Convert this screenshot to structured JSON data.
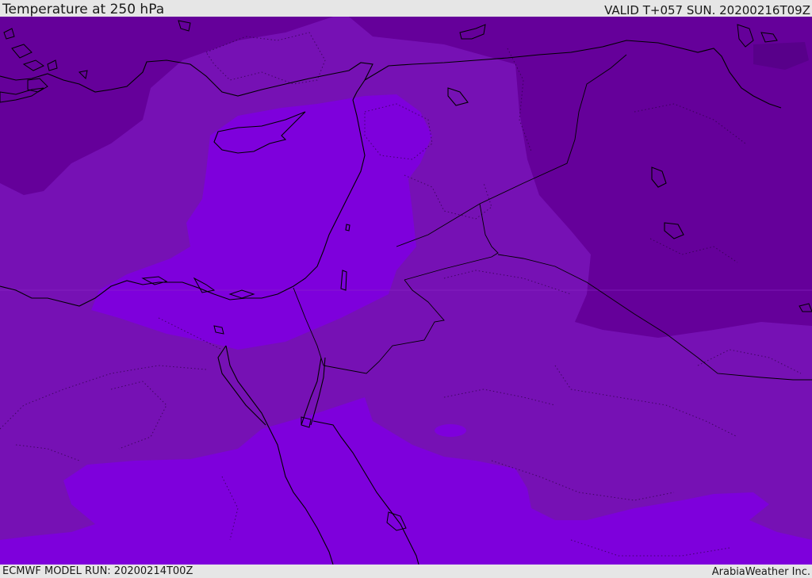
{
  "header": {
    "title": "Temperature at 250 hPa",
    "valid_time": "VALID T+057 SUN. 20200216T09Z"
  },
  "footer": {
    "model_run": "ECMWF MODEL RUN: 20200214T00Z",
    "credit": "ArabiaWeather Inc."
  },
  "map": {
    "variable": "temperature",
    "level": "250 hPa",
    "colors": {
      "coldest": "#620096",
      "cold": "#7610b2",
      "mid": "#790fbd",
      "warm": "#7f00dc",
      "coastline": "#000000",
      "border": "#000000"
    }
  }
}
